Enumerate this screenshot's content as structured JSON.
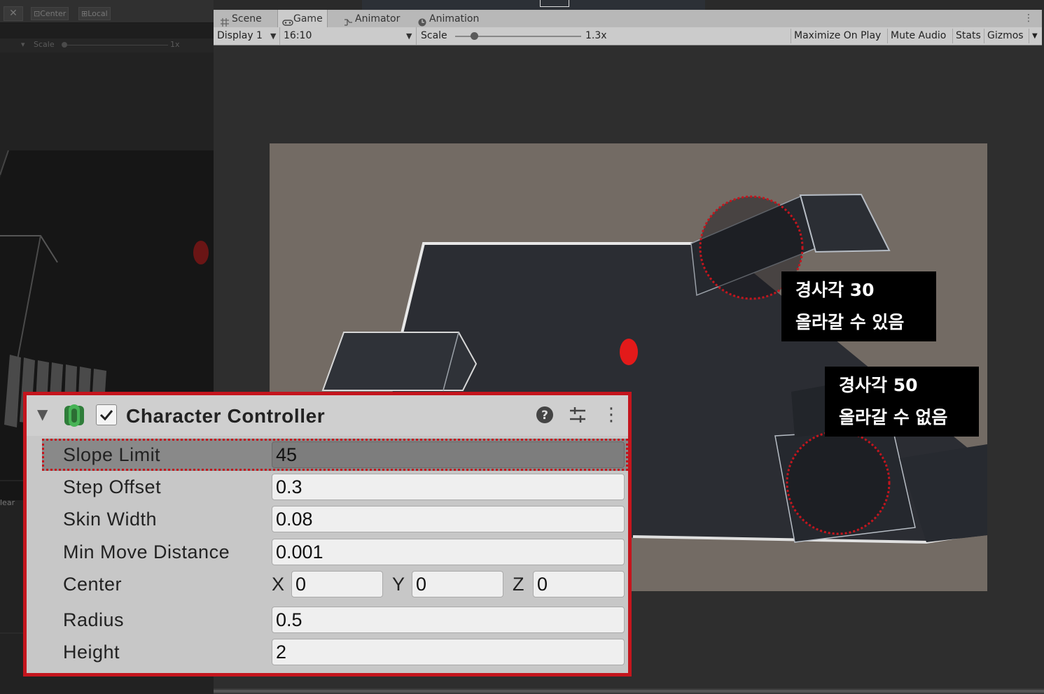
{
  "scene_toolbar": {
    "center_label": "Center",
    "local_label": "Local",
    "scale_label": "Scale",
    "scale_value": "1x"
  },
  "scene_partial_label": "lear",
  "tabs": [
    {
      "label": "Scene",
      "icon": "grid-icon",
      "active": false
    },
    {
      "label": "Game",
      "icon": "gamepad-icon",
      "active": true
    },
    {
      "label": "Animator",
      "icon": "animator-icon",
      "active": false
    },
    {
      "label": "Animation",
      "icon": "animation-clock-icon",
      "active": false
    }
  ],
  "game_toolbar": {
    "display": "Display 1",
    "aspect": "16:10",
    "scale_label": "Scale",
    "scale_value": "1.3x",
    "scale_fraction": 0.15,
    "maximize_on_play": "Maximize On Play",
    "mute_audio": "Mute Audio",
    "stats": "Stats",
    "gizmos": "Gizmos"
  },
  "callouts": [
    {
      "line1": "경사각 30",
      "line2": "올라갈 수 있음"
    },
    {
      "line1": "경사각 50",
      "line2": "올라갈 수 없음"
    }
  ],
  "inspector": {
    "component_title": "Character Controller",
    "enabled": true,
    "properties": {
      "slope_limit": {
        "label": "Slope Limit",
        "value": "45"
      },
      "step_offset": {
        "label": "Step Offset",
        "value": "0.3"
      },
      "skin_width": {
        "label": "Skin Width",
        "value": "0.08"
      },
      "min_move_distance": {
        "label": "Min Move Distance",
        "value": "0.001"
      },
      "center": {
        "label": "Center",
        "x_label": "X",
        "x": "0",
        "y_label": "Y",
        "y": "0",
        "z_label": "Z",
        "z": "0"
      },
      "radius": {
        "label": "Radius",
        "value": "0.5"
      },
      "height": {
        "label": "Height",
        "value": "2"
      }
    }
  },
  "colors": {
    "highlight_red": "#c4151d",
    "player_red": "#e31a1a",
    "floor": "#2b2d33",
    "background": "#736b64"
  }
}
